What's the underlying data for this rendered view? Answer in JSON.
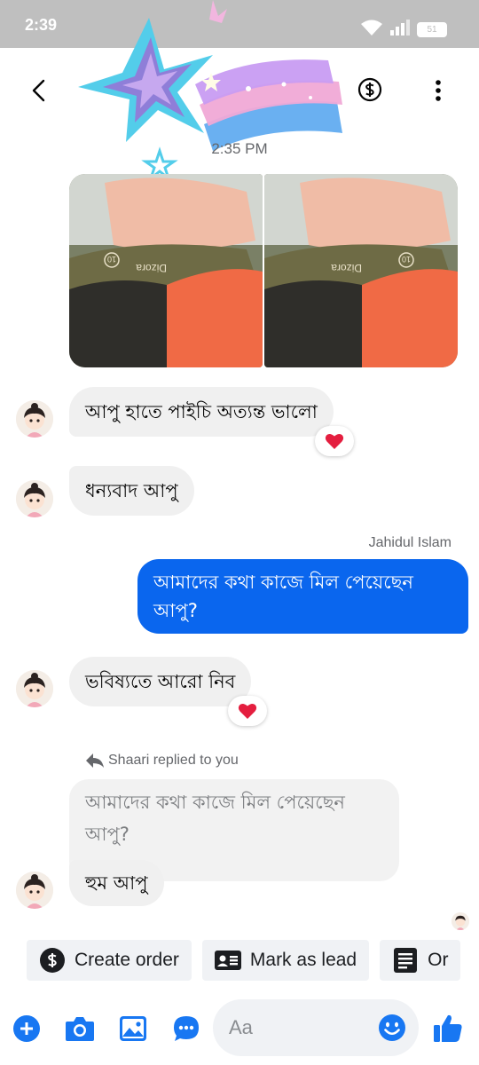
{
  "status_bar": {
    "time": "2:39",
    "battery": "51"
  },
  "conversation": {
    "timestamp": "2:35 PM"
  },
  "attachments": [
    {
      "tag": "Dizora",
      "size": "10"
    },
    {
      "tag": "Dizora",
      "size": "10"
    }
  ],
  "messages": [
    {
      "direction": "received",
      "text": "আপু হাতে পাইচি অত্যন্ত ভালো",
      "reaction": "heart"
    },
    {
      "direction": "received",
      "text": "ধন্যবাদ আপু"
    },
    {
      "direction": "sent",
      "sender": "Jahidul Islam",
      "lines": [
        "আমাদের কথা কাজে মিল পেয়েছেন",
        "আপু?"
      ]
    },
    {
      "direction": "received",
      "text": "ভবিষ্যতে আরো নিব",
      "reaction": "heart"
    },
    {
      "direction": "received",
      "reply_label": "Shaari replied to you",
      "quoted_lines": [
        "আমাদের কথা কাজে মিল পেয়েছেন",
        "আপু?"
      ],
      "text": "হুম আপু"
    }
  ],
  "quick_actions": [
    {
      "label": "Create order",
      "icon": "dollar-circle-icon"
    },
    {
      "label": "Mark as lead",
      "icon": "contact-card-icon"
    },
    {
      "label": "Or",
      "icon": "order-list-icon"
    }
  ],
  "composer": {
    "placeholder": "Aa"
  },
  "colors": {
    "accent": "#0a66ee",
    "icon_blue": "#1877f2",
    "reaction_red": "#e41e3f"
  }
}
